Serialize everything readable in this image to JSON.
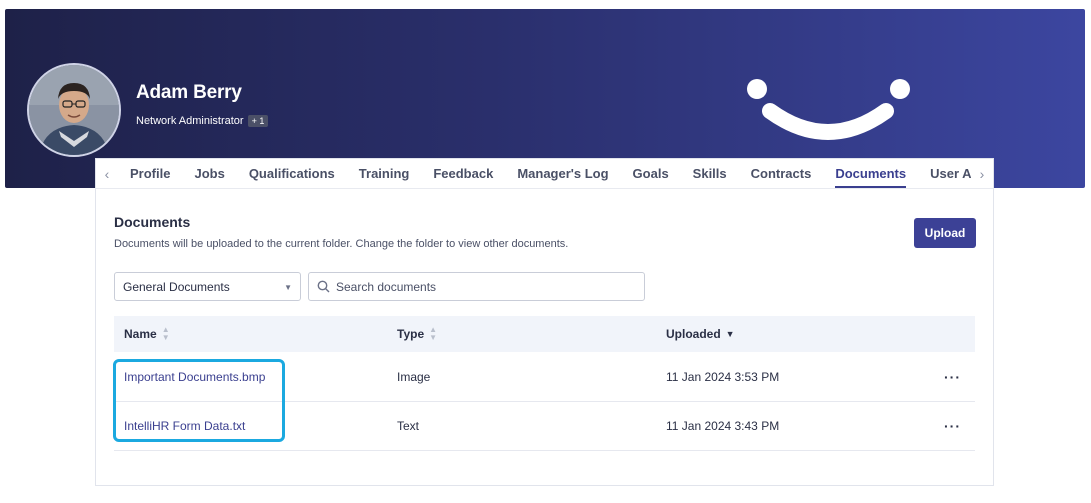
{
  "profile": {
    "name": "Adam Berry",
    "role": "Network Administrator",
    "role_badge": "+ 1"
  },
  "tabs": [
    {
      "label": "Profile"
    },
    {
      "label": "Jobs"
    },
    {
      "label": "Qualifications"
    },
    {
      "label": "Training"
    },
    {
      "label": "Feedback"
    },
    {
      "label": "Manager's Log"
    },
    {
      "label": "Goals"
    },
    {
      "label": "Skills"
    },
    {
      "label": "Contracts"
    },
    {
      "label": "Documents",
      "active": true
    },
    {
      "label": "User Account"
    }
  ],
  "documents": {
    "title": "Documents",
    "description": "Documents will be uploaded to the current folder. Change the folder to view other documents.",
    "upload_label": "Upload",
    "folder": "General Documents",
    "search_placeholder": "Search documents",
    "columns": {
      "name": "Name",
      "type": "Type",
      "uploaded": "Uploaded"
    },
    "rows": [
      {
        "name": "Important Documents.bmp",
        "type": "Image",
        "uploaded": "11 Jan 2024 3:53 PM"
      },
      {
        "name": "IntelliHR Form Data.txt",
        "type": "Text",
        "uploaded": "11 Jan 2024 3:43 PM"
      }
    ]
  },
  "colors": {
    "accent": "#3c4196",
    "highlight": "#1ba9e0",
    "banner_dark": "#1e2148",
    "banner_light": "#3c46a0"
  }
}
